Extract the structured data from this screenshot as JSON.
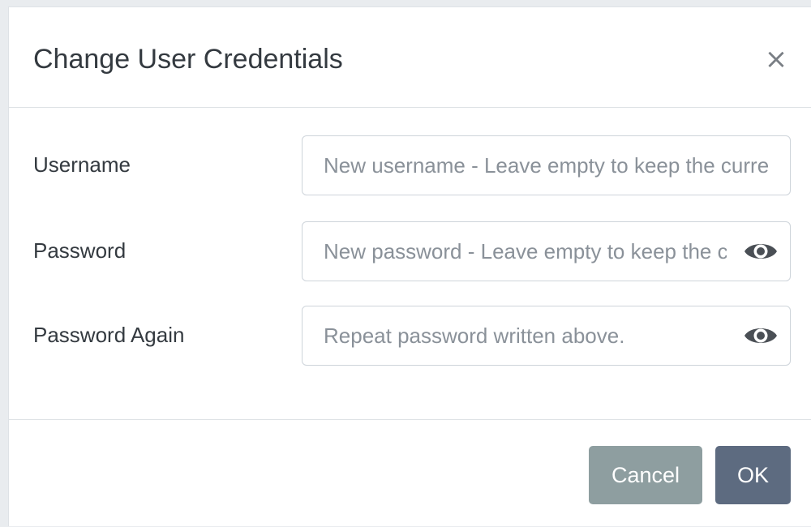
{
  "dialog": {
    "title": "Change User Credentials",
    "close_label": "×"
  },
  "form": {
    "username": {
      "label": "Username",
      "value": "",
      "placeholder": "New username - Leave empty to keep the current"
    },
    "password": {
      "label": "Password",
      "value": "",
      "placeholder": "New password - Leave empty to keep the current",
      "toggle_icon": "eye-icon"
    },
    "password_again": {
      "label": "Password Again",
      "value": "",
      "placeholder": "Repeat password written above.",
      "toggle_icon": "eye-icon"
    }
  },
  "footer": {
    "cancel_label": "Cancel",
    "ok_label": "OK"
  },
  "colors": {
    "cancel_button": "#8e9ea0",
    "ok_button": "#5d6b80",
    "placeholder_text": "#8a9199",
    "input_border": "#ced4da"
  }
}
